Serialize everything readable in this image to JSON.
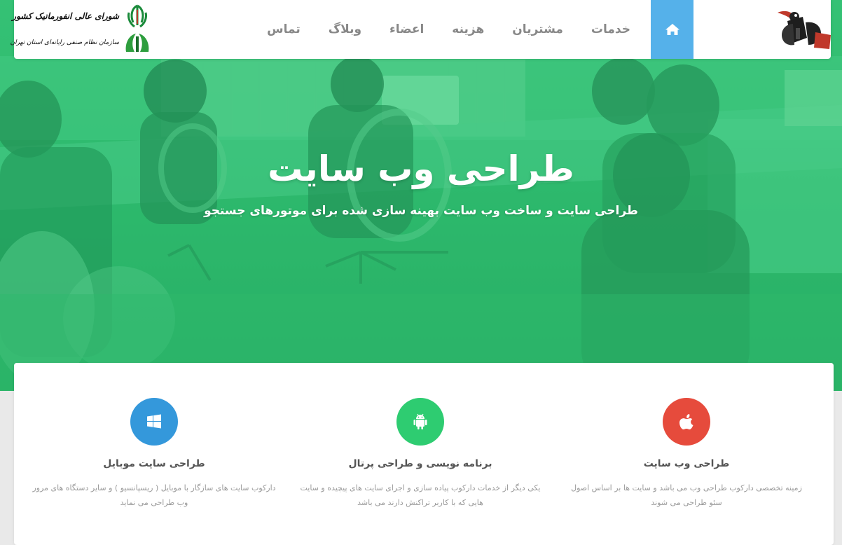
{
  "hero": {
    "title": "طراحی وب سایت",
    "subtitle": "طراحی سایت و ساخت وب سایت بهینه سازی شده برای موتورهای جستجو"
  },
  "nav": {
    "home_icon": "home-icon",
    "items": [
      "خدمات",
      "مشتریان",
      "هزینه",
      "اعضاء",
      "وبلاگ",
      "تماس"
    ]
  },
  "partner": {
    "line1": "شورای عالی انفورماتیک کشور",
    "line2": "سازمان نظام صنفی رایانه‌ای استان تهران"
  },
  "features": [
    {
      "icon": "apple-icon",
      "color": "#e64b3c",
      "title": "طراحی وب سایت",
      "desc": "زمینه تخصصی دارکوب طراحی وب می باشد و سایت ها بر اساس اصول سئو طراحی می شوند"
    },
    {
      "icon": "android-icon",
      "color": "#2ecc71",
      "title": "برنامه نویسی و طراحی پرتال",
      "desc": "یکی دیگر از خدمات دارکوب پیاده سازی و اجرای سایت های پیچیده و سایت هایی که با کاربر تراکنش دارند می باشد"
    },
    {
      "icon": "windows-icon",
      "color": "#3498db",
      "title": "طراحی سایت موبایل",
      "desc": "دارکوب سایت های سازگار با موبایل ( ریسپانسیو ) و سایر دستگاه های مرور وب طراحی می نماید"
    }
  ],
  "colors": {
    "accent": "#55b1ea",
    "hero_green": "#2fb56b"
  }
}
